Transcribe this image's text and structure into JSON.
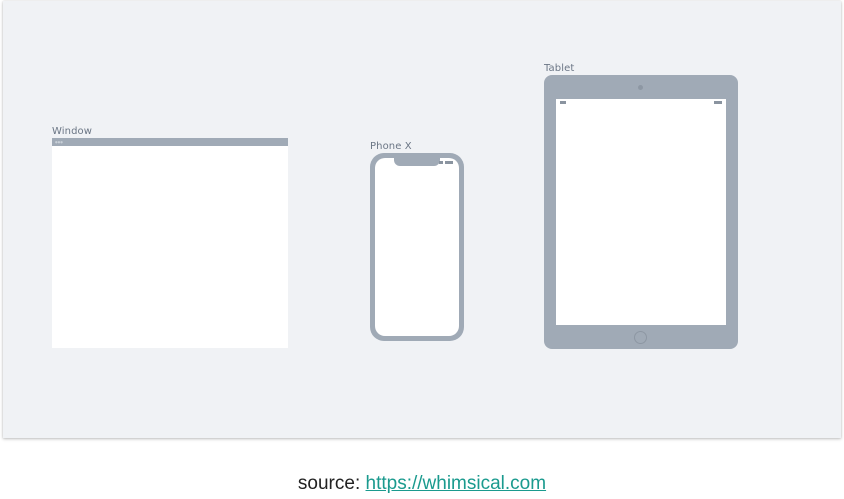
{
  "frames": {
    "window": {
      "label": "Window"
    },
    "phone": {
      "label": "Phone X"
    },
    "tablet": {
      "label": "Tablet"
    }
  },
  "footer": {
    "prefix": "source: ",
    "link_text": "https://whimsical.com"
  },
  "colors": {
    "canvas": "#f0f2f5",
    "device": "#a0aab6",
    "label": "#6b7685",
    "link": "#1a9a8e"
  }
}
